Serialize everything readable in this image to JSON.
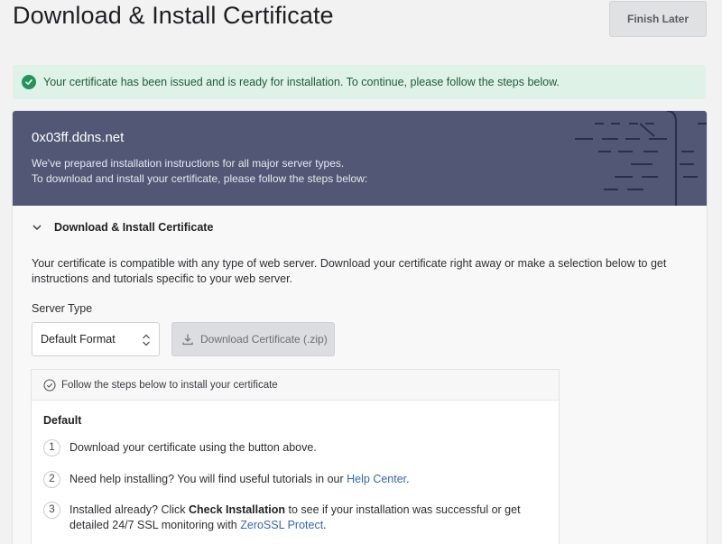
{
  "page": {
    "title": "Download & Install Certificate",
    "finish_later": "Finish Later"
  },
  "alert": {
    "text": "Your certificate has been issued and is ready for installation. To continue, please follow the steps below."
  },
  "card": {
    "domain": "0x03ff.ddns.net",
    "line1": "We've prepared installation instructions for all major server types.",
    "line2": "To download and install your certificate, please follow the steps below:"
  },
  "section": {
    "title": "Download & Install Certificate",
    "description": "Your certificate is compatible with any type of web server. Download your certificate right away or make a selection below to get instructions and tutorials specific to your web server.",
    "server_type_label": "Server Type",
    "server_type_value": "Default Format",
    "download_button": "Download Certificate (.zip)"
  },
  "steps": {
    "header": "Follow the steps below to install your certificate",
    "group_label": "Default",
    "items": [
      {
        "num": "1",
        "text": "Download your certificate using the button above."
      },
      {
        "num": "2",
        "text_before": "Need help installing? You will find useful tutorials in our ",
        "link": "Help Center",
        "text_after": "."
      },
      {
        "num": "3",
        "text_before": "Installed already? Click ",
        "bold": "Check Installation",
        "text_mid": " to see if your installation was successful or get detailed 24/7 SSL monitoring with ",
        "link": "ZeroSSL Protect",
        "text_after": "."
      }
    ]
  },
  "colors": {
    "header_bg": "#515775",
    "alert_bg": "#def2e8",
    "success": "#23945c",
    "link": "#3566b4"
  },
  "icons": [
    "check-circle-icon",
    "chevron-down-icon",
    "updown-icon",
    "download-icon",
    "circle-check-icon"
  ]
}
